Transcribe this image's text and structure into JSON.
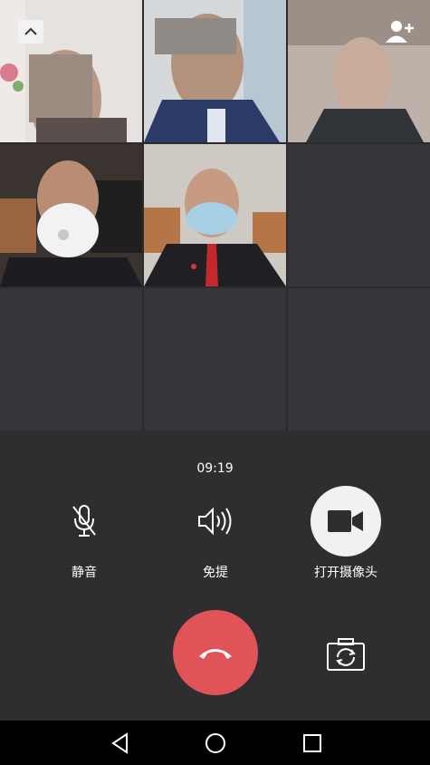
{
  "call": {
    "timer": "09:19",
    "controls": {
      "mute_label": "静音",
      "speaker_label": "免提",
      "camera_label": "打开摄像头"
    }
  },
  "participants": [
    {
      "id": "p1",
      "state": "video"
    },
    {
      "id": "p2",
      "state": "video"
    },
    {
      "id": "p3",
      "state": "video"
    },
    {
      "id": "p4",
      "state": "video"
    },
    {
      "id": "p5",
      "state": "video"
    }
  ],
  "colors": {
    "hangup": "#e05457",
    "background": "#2e2e30",
    "empty_tile": "#35363a"
  },
  "icons": [
    "chevron-up-icon",
    "add-user-icon",
    "mic-off-icon",
    "speaker-icon",
    "camera-icon",
    "hangup-icon",
    "flip-camera-icon",
    "back-icon",
    "home-icon",
    "recents-icon"
  ]
}
